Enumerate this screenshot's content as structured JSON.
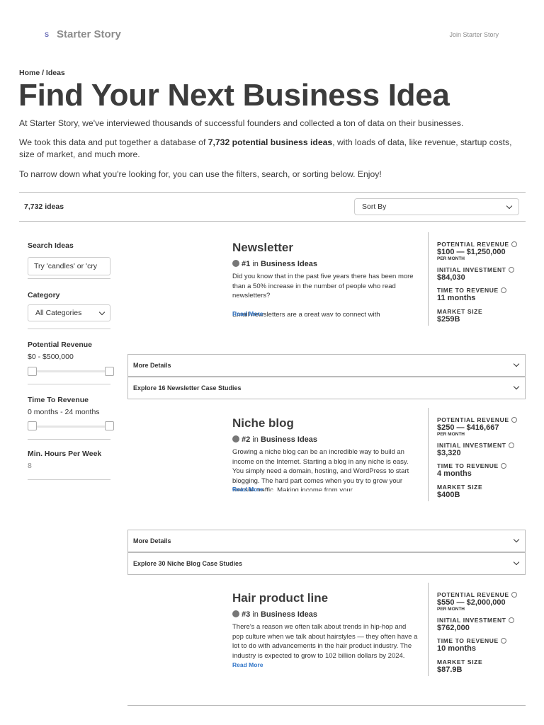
{
  "nav": {
    "logo": "S",
    "brand": "Starter Story",
    "join": "Join Starter Story"
  },
  "breadcrumb": "Home / Ideas",
  "page_title": "Find Your Next Business Idea",
  "intro": {
    "p1": "At Starter Story, we've interviewed thousands of successful founders and collected a ton of data on their businesses.",
    "p2_before": "We took this data and put together a database of ",
    "p2_bold": "7,732 potential business ideas",
    "p2_after": ", with loads of data, like revenue, startup costs, size of market, and much more.",
    "p3": "To narrow down what you're looking for, you can use the filters, search, or sorting below. Enjoy!"
  },
  "toolbar": {
    "count": "7,732 ideas",
    "sort_label": "Sort By"
  },
  "filters": {
    "search_label": "Search Ideas",
    "search_placeholder": "Try 'candles' or 'cry",
    "category_label": "Category",
    "category_value": "All Categories",
    "revenue_label": "Potential Revenue",
    "revenue_value": "$0 - $500,000",
    "time_label": "Time To Revenue",
    "time_value": "0 months - 24 months",
    "hours_label": "Min. Hours Per Week",
    "hours_value": "8"
  },
  "stat_labels": {
    "revenue": "POTENTIAL REVENUE",
    "per_month": "PER MONTH",
    "investment": "INITIAL INVESTMENT",
    "time": "TIME TO REVENUE",
    "market": "MARKET SIZE"
  },
  "rank_in": "in",
  "read_more": "Read More",
  "ideas": [
    {
      "title": "Newsletter",
      "rank": "#1",
      "category": "Business Ideas",
      "description": "Did you know that in the past five years there has been more than a 50% increase in the number of people who read newsletters?\n\nEmail newsletters are a great way to connect with",
      "revenue": "$100 — $1,250,000",
      "investment": "$84,030",
      "time": "11 months",
      "market": "$259B",
      "more_details": "More Details",
      "case_studies": "Explore 16 Newsletter Case Studies"
    },
    {
      "title": "Niche blog",
      "rank": "#2",
      "category": "Business Ideas",
      "description": "Growing a niche blog can be an incredible way to build an income on the Internet. Starting a blog in any niche is easy. You simply need a domain, hosting, and WordPress to start blogging. The hard part comes when you try to grow your website traffic. Making income from your",
      "revenue": "$250 — $416,667",
      "investment": "$3,320",
      "time": "4 months",
      "market": "$400B",
      "more_details": "More Details",
      "case_studies": "Explore 30 Niche Blog Case Studies"
    },
    {
      "title": "Hair product line",
      "rank": "#3",
      "category": "Business Ideas",
      "description": "There's a reason we often talk about trends in hip-hop and pop culture when we talk about hairstyles — they often have a lot to do with advancements in the hair product industry. The industry is expected to grow to 102 billion dollars by 2024.",
      "revenue": "$550 — $2,000,000",
      "investment": "$762,000",
      "time": "10 months",
      "market": "$87.9B"
    }
  ]
}
